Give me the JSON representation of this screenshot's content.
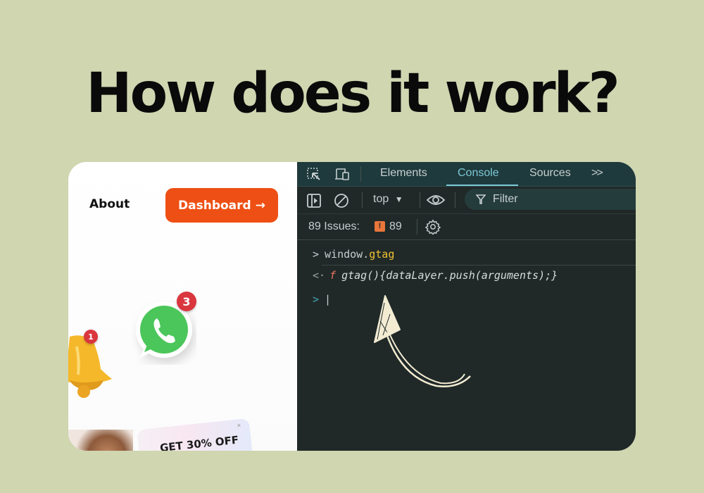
{
  "headline": "How does it work?",
  "website": {
    "nav_about": "About",
    "dashboard_button": "Dashboard",
    "dashboard_arrow": "→",
    "whatsapp_badge": "3",
    "bell_badge": "1",
    "promo_text": "GET 30% OFF",
    "promo_close": "×",
    "accent_color": "#ee4f14"
  },
  "devtools": {
    "tabs": [
      {
        "label": "Elements",
        "active": false
      },
      {
        "label": "Console",
        "active": true
      },
      {
        "label": "Sources",
        "active": false
      }
    ],
    "more_tabs": ">>",
    "context": "top",
    "filter_placeholder": "Filter",
    "issues_label": "89 Issues:",
    "issues_count": "89",
    "console": {
      "input_prompt": ">",
      "input_object": "window.",
      "input_property": "gtag",
      "output_prompt": "<·",
      "output_f": "f",
      "output_text": "gtag(){dataLayer.push(arguments);}",
      "cursor_prompt": ">"
    },
    "colors": {
      "active_tab": "#7cc7d6",
      "highlight": "#f1c232",
      "function_f": "#e8735a",
      "issue_badge": "#e8753a"
    }
  },
  "annotation": "hand-drawn-arrow"
}
